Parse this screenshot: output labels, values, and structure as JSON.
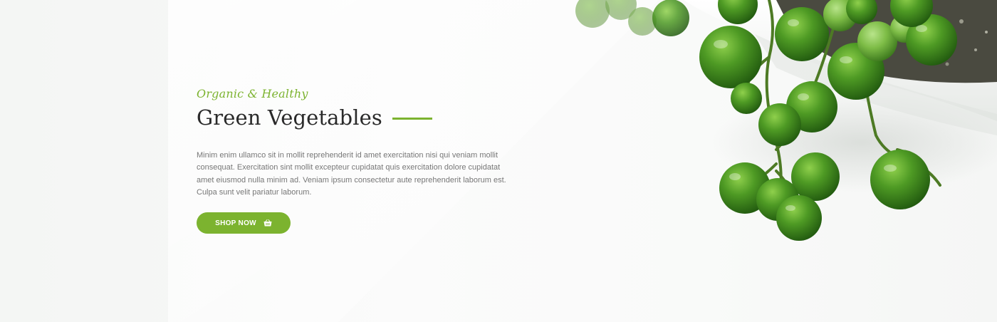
{
  "hero": {
    "subtitle": "Organic & Healthy",
    "title": "Green Vegetables",
    "description": "Minim enim ullamco sit in mollit reprehenderit id amet exercitation nisi qui veniam mollit consequat. Exercitation sint mollit excepteur cupidatat quis exercitation dolore cupidatat amet eiusmod nulla minim ad. Veniam ipsum consectetur aute reprehenderit laborum est. Culpa sunt velit pariatur laborum.",
    "button_label": "SHOP NOW",
    "button_icon": "basket-icon"
  },
  "colors": {
    "accent": "#7cb32f",
    "title": "#2a2a2a",
    "text": "#777777",
    "background": "#f7f8f7"
  }
}
